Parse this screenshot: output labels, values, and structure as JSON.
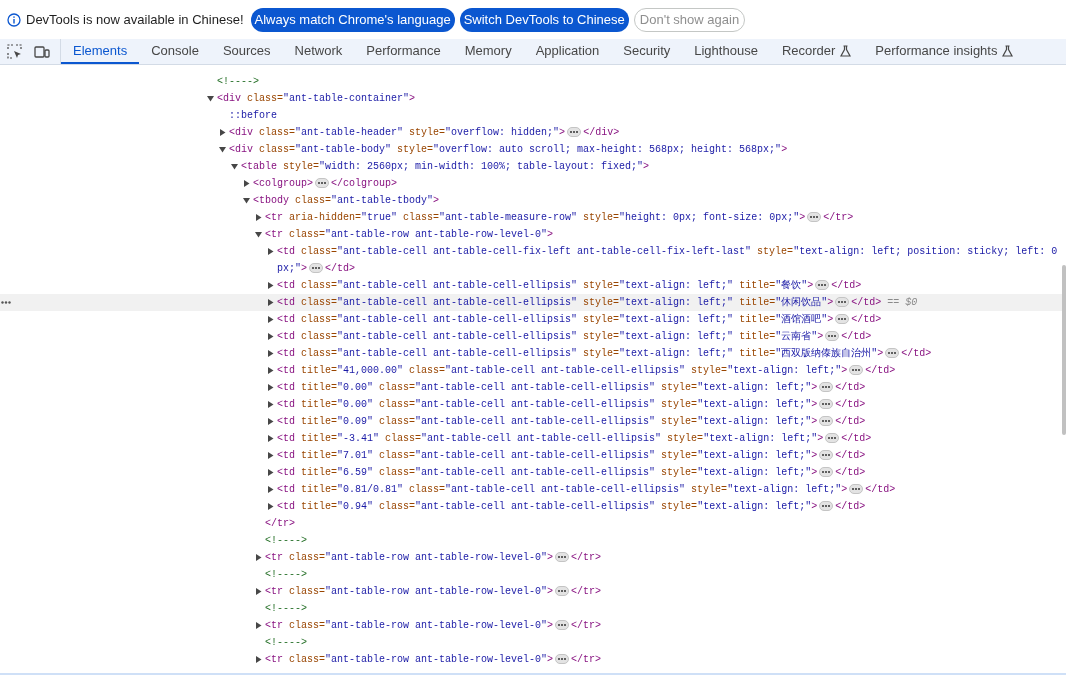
{
  "infobar": {
    "message": "DevTools is now available in Chinese!",
    "buttons": [
      {
        "label": "Always match Chrome's language",
        "kind": "primary"
      },
      {
        "label": "Switch DevTools to Chinese",
        "kind": "primary"
      },
      {
        "label": "Don't show again",
        "kind": "outline"
      }
    ]
  },
  "tabs": [
    {
      "label": "Elements",
      "selected": true
    },
    {
      "label": "Console",
      "selected": false
    },
    {
      "label": "Sources",
      "selected": false
    },
    {
      "label": "Network",
      "selected": false
    },
    {
      "label": "Performance",
      "selected": false
    },
    {
      "label": "Memory",
      "selected": false
    },
    {
      "label": "Application",
      "selected": false
    },
    {
      "label": "Security",
      "selected": false
    },
    {
      "label": "Lighthouse",
      "selected": false
    },
    {
      "label": "Recorder",
      "selected": false,
      "experimental": true
    },
    {
      "label": "Performance insights",
      "selected": false,
      "experimental": true
    }
  ],
  "tree": [
    {
      "kind": "comment",
      "text": "<!---->"
    },
    {
      "kind": "element",
      "open": "<div class=\"ant-table-container\">",
      "expanded": true,
      "selected": false,
      "children": [
        {
          "kind": "pseudo",
          "text": "::before"
        },
        {
          "kind": "element",
          "open": "<div class=\"ant-table-header\" style=\"overflow: hidden;\">",
          "close": "</div>",
          "expanded": false,
          "selected": false
        },
        {
          "kind": "element",
          "open": "<div class=\"ant-table-body\" style=\"overflow: auto scroll; max-height: 568px; height: 568px;\">",
          "expanded": true,
          "selected": false,
          "children": [
            {
              "kind": "element",
              "open": "<table style=\"width: 2560px; min-width: 100%; table-layout: fixed;\">",
              "expanded": true,
              "selected": false,
              "children": [
                {
                  "kind": "element",
                  "open": "<colgroup>",
                  "close": "</colgroup>",
                  "expanded": false,
                  "selected": false
                },
                {
                  "kind": "element",
                  "open": "<tbody class=\"ant-table-tbody\">",
                  "expanded": true,
                  "selected": false,
                  "children": [
                    {
                      "kind": "element",
                      "open": "<tr aria-hidden=\"true\" class=\"ant-table-measure-row\" style=\"height: 0px; font-size: 0px;\">",
                      "close": "</tr>",
                      "expanded": false,
                      "selected": false
                    },
                    {
                      "kind": "element",
                      "open": "<tr class=\"ant-table-row ant-table-row-level-0\">",
                      "expanded": true,
                      "selected": false,
                      "children": [
                        {
                          "kind": "element",
                          "open": "<td class=\"ant-table-cell ant-table-cell-fix-left ant-table-cell-fix-left-last\" style=\"text-align: left; position: sticky; left: 0px;\">",
                          "close": "</td>",
                          "expanded": false,
                          "selected": false
                        },
                        {
                          "kind": "element",
                          "open": "<td class=\"ant-table-cell ant-table-cell-ellipsis\" style=\"text-align: left;\" title=\"餐饮\">",
                          "close": "</td>",
                          "expanded": false,
                          "selected": false
                        },
                        {
                          "kind": "element",
                          "open": "<td class=\"ant-table-cell ant-table-cell-ellipsis\" style=\"text-align: left;\" title=\"休闲饮品\">",
                          "close": "</td>",
                          "expanded": false,
                          "selected": true,
                          "marker": "== $0"
                        },
                        {
                          "kind": "element",
                          "open": "<td class=\"ant-table-cell ant-table-cell-ellipsis\" style=\"text-align: left;\" title=\"酒馆酒吧\">",
                          "close": "</td>",
                          "expanded": false,
                          "selected": false
                        },
                        {
                          "kind": "element",
                          "open": "<td class=\"ant-table-cell ant-table-cell-ellipsis\" style=\"text-align: left;\" title=\"云南省\">",
                          "close": "</td>",
                          "expanded": false,
                          "selected": false
                        },
                        {
                          "kind": "element",
                          "open": "<td class=\"ant-table-cell ant-table-cell-ellipsis\" style=\"text-align: left;\" title=\"西双版纳傣族自治州\">",
                          "close": "</td>",
                          "expanded": false,
                          "selected": false
                        },
                        {
                          "kind": "element",
                          "open": "<td title=\"41,000.00\" class=\"ant-table-cell ant-table-cell-ellipsis\" style=\"text-align: left;\">",
                          "close": "</td>",
                          "expanded": false,
                          "selected": false
                        },
                        {
                          "kind": "element",
                          "open": "<td title=\"0.00\" class=\"ant-table-cell ant-table-cell-ellipsis\" style=\"text-align: left;\">",
                          "close": "</td>",
                          "expanded": false,
                          "selected": false
                        },
                        {
                          "kind": "element",
                          "open": "<td title=\"0.00\" class=\"ant-table-cell ant-table-cell-ellipsis\" style=\"text-align: left;\">",
                          "close": "</td>",
                          "expanded": false,
                          "selected": false
                        },
                        {
                          "kind": "element",
                          "open": "<td title=\"0.09\" class=\"ant-table-cell ant-table-cell-ellipsis\" style=\"text-align: left;\">",
                          "close": "</td>",
                          "expanded": false,
                          "selected": false
                        },
                        {
                          "kind": "element",
                          "open": "<td title=\"-3.41\" class=\"ant-table-cell ant-table-cell-ellipsis\" style=\"text-align: left;\">",
                          "close": "</td>",
                          "expanded": false,
                          "selected": false
                        },
                        {
                          "kind": "element",
                          "open": "<td title=\"7.01\" class=\"ant-table-cell ant-table-cell-ellipsis\" style=\"text-align: left;\">",
                          "close": "</td>",
                          "expanded": false,
                          "selected": false
                        },
                        {
                          "kind": "element",
                          "open": "<td title=\"6.59\" class=\"ant-table-cell ant-table-cell-ellipsis\" style=\"text-align: left;\">",
                          "close": "</td>",
                          "expanded": false,
                          "selected": false
                        },
                        {
                          "kind": "element",
                          "open": "<td title=\"0.81/0.81\" class=\"ant-table-cell ant-table-cell-ellipsis\" style=\"text-align: left;\">",
                          "close": "</td>",
                          "expanded": false,
                          "selected": false
                        },
                        {
                          "kind": "element",
                          "open": "<td title=\"0.94\" class=\"ant-table-cell ant-table-cell-ellipsis\" style=\"text-align: left;\">",
                          "close": "</td>",
                          "expanded": false,
                          "selected": false
                        }
                      ]
                    },
                    {
                      "kind": "close",
                      "text": "</tr>"
                    },
                    {
                      "kind": "comment",
                      "text": "<!---->"
                    },
                    {
                      "kind": "element",
                      "open": "<tr class=\"ant-table-row ant-table-row-level-0\">",
                      "close": "</tr>",
                      "expanded": false,
                      "selected": false
                    },
                    {
                      "kind": "comment",
                      "text": "<!---->"
                    },
                    {
                      "kind": "element",
                      "open": "<tr class=\"ant-table-row ant-table-row-level-0\">",
                      "close": "</tr>",
                      "expanded": false,
                      "selected": false
                    },
                    {
                      "kind": "comment",
                      "text": "<!---->"
                    },
                    {
                      "kind": "element",
                      "open": "<tr class=\"ant-table-row ant-table-row-level-0\">",
                      "close": "</tr>",
                      "expanded": false,
                      "selected": false
                    },
                    {
                      "kind": "comment",
                      "text": "<!---->"
                    },
                    {
                      "kind": "element",
                      "open": "<tr class=\"ant-table-row ant-table-row-level-0\">",
                      "close": "</tr>",
                      "expanded": false,
                      "selected": false
                    }
                  ]
                }
              ]
            }
          ]
        }
      ]
    }
  ]
}
